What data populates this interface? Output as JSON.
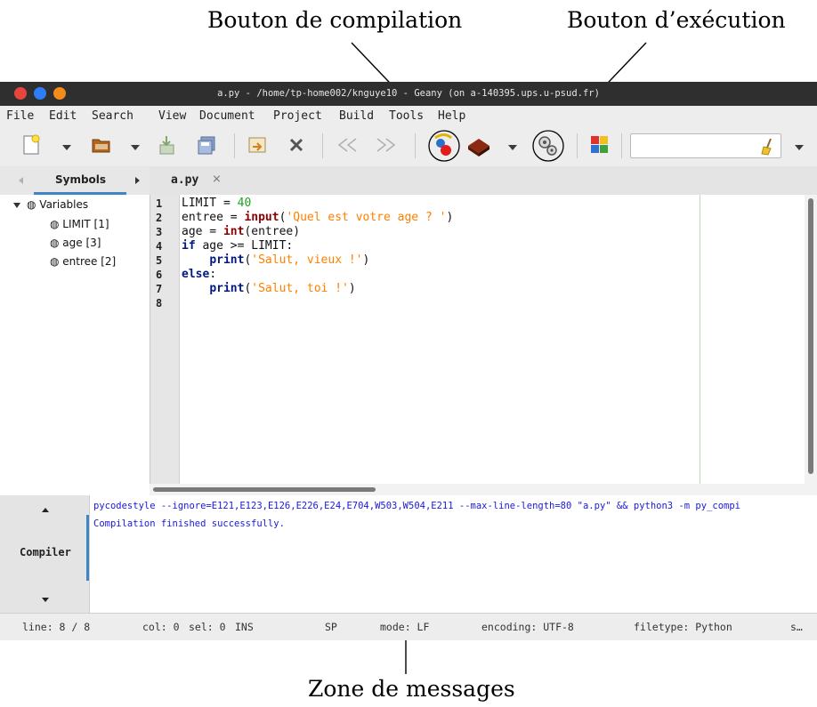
{
  "annotations": {
    "compile": "Bouton de compilation",
    "execute": "Bouton d’exécution",
    "messages": "Zone de messages"
  },
  "window": {
    "title": "a.py - /home/tp-home002/knguye10 - Geany (on a-140395.ups.u-psud.fr)"
  },
  "menubar": [
    "File",
    "Edit",
    "Search",
    "View",
    "Document",
    "Project",
    "Build",
    "Tools",
    "Help"
  ],
  "toolbar": {
    "icons": [
      "new-file-icon",
      "open-file-icon",
      "save-icon",
      "save-all-icon",
      "revert-icon",
      "close-icon",
      "navigate-back-icon",
      "navigate-forward-icon",
      "compile-icon",
      "build-icon",
      "execute-icon",
      "color-chooser-icon",
      "clear-search-icon"
    ],
    "search_value": ""
  },
  "sidebar": {
    "tab_label": "Symbols",
    "tree": {
      "group": "Variables",
      "items": [
        "LIMIT [1]",
        "age [3]",
        "entree [2]"
      ]
    }
  },
  "editor": {
    "tab_label": "a.py",
    "line_numbers": [
      "1",
      "2",
      "3",
      "4",
      "5",
      "6",
      "7",
      "8"
    ],
    "code": {
      "l1": {
        "a": "LIMIT = ",
        "b": "40"
      },
      "l2": {
        "a": "entree = ",
        "b": "input",
        "c": "(",
        "d": "'Quel est votre age ? '",
        "e": ")"
      },
      "l3": {
        "a": "age = ",
        "b": "int",
        "c": "(entree)"
      },
      "l4": {
        "a": "if",
        "b": " age >= LIMIT:"
      },
      "l5": {
        "a": "    ",
        "b": "print",
        "c": "(",
        "d": "'Salut, vieux !'",
        "e": ")"
      },
      "l6": {
        "a": "else",
        "b": ":"
      },
      "l7": {
        "a": "    ",
        "b": "print",
        "c": "(",
        "d": "'Salut, toi !'",
        "e": ")"
      }
    }
  },
  "messages": {
    "tab_label": "Compiler",
    "lines": [
      "pycodestyle --ignore=E121,E123,E126,E226,E24,E704,W503,W504,E211 --max-line-length=80 \"a.py\" && python3 -m py_compi",
      "Compilation finished successfully."
    ]
  },
  "statusbar": {
    "line": "line: 8 / 8",
    "col": "col: 0",
    "sel": "sel: 0",
    "ins": "INS",
    "sp": "SP",
    "mode": "mode: LF",
    "encoding": "encoding: UTF-8",
    "filetype": "filetype: Python",
    "more": "s…"
  },
  "colors": {
    "titlebar_bg": "#2f2f2f",
    "close_button": "#e8453c",
    "minimize_button": "#2f7df6",
    "maximize_button": "#f28c1c",
    "keyword": "#001a80",
    "builtin": "#8b0000",
    "string": "#ff7f00",
    "number": "#20a020",
    "message_text": "#1a1ad6",
    "tab_underline": "#3d85c6"
  }
}
